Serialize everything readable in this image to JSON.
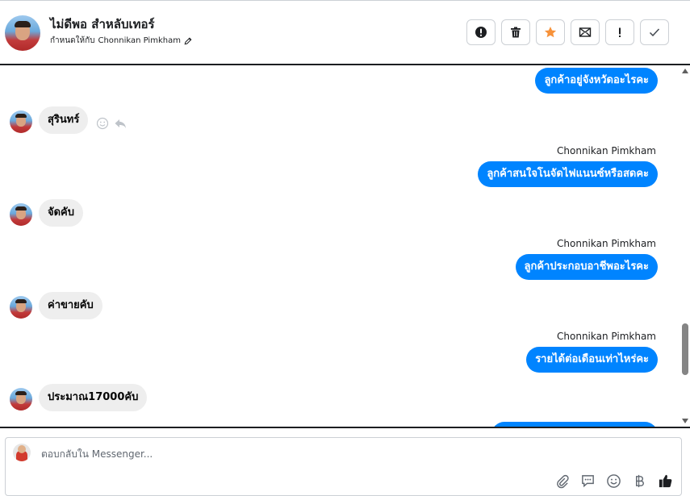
{
  "header": {
    "contact_name": "ไม่ดีพอ สำหลับเทอร์",
    "assigned_prefix": "กำหนดให้กับ",
    "assigned_to": "Chonnikan Pimkham",
    "actions": [
      {
        "name": "mark-spam",
        "icon": "exclamation-circle-icon"
      },
      {
        "name": "delete",
        "icon": "trash-icon"
      },
      {
        "name": "star",
        "icon": "star-icon",
        "color": "#f7923a"
      },
      {
        "name": "mark-unread",
        "icon": "envelope-icon"
      },
      {
        "name": "follow-up",
        "icon": "exclamation-icon"
      },
      {
        "name": "mark-done",
        "icon": "check-icon"
      }
    ]
  },
  "thread": {
    "agent_name": "Chonnikan Pimkham",
    "messages": [
      {
        "direction": "out",
        "text": "ลูกค้าอยู่จังหวัดอะไรคะ"
      },
      {
        "direction": "in",
        "text": "สุรินทร์"
      },
      {
        "direction": "out",
        "sender": "Chonnikan Pimkham",
        "text": "ลูกค้าสนใจโนจัดไฟแนนซ์หรือสดคะ"
      },
      {
        "direction": "in",
        "text": "จัดคับ"
      },
      {
        "direction": "out",
        "sender": "Chonnikan Pimkham",
        "text": "ลูกค้าประกอบอาชีพอะไรคะ"
      },
      {
        "direction": "in",
        "text": "ค่าขายคับ"
      },
      {
        "direction": "out",
        "sender": "Chonnikan Pimkham",
        "text": "รายได้ต่อเดือนเท่าไหร่คะ"
      },
      {
        "direction": "in",
        "text": "ประมาณ17000คับ"
      }
    ]
  },
  "composer": {
    "placeholder": "ตอบกลับใน Messenger...",
    "tools": [
      "paperclip-icon",
      "saved-reply-icon",
      "emoji-icon",
      "baht-icon",
      "thumbs-up-icon"
    ]
  },
  "colors": {
    "outgoing_bubble": "#0084ff",
    "incoming_bubble": "#eeeeee",
    "star": "#f7923a"
  }
}
